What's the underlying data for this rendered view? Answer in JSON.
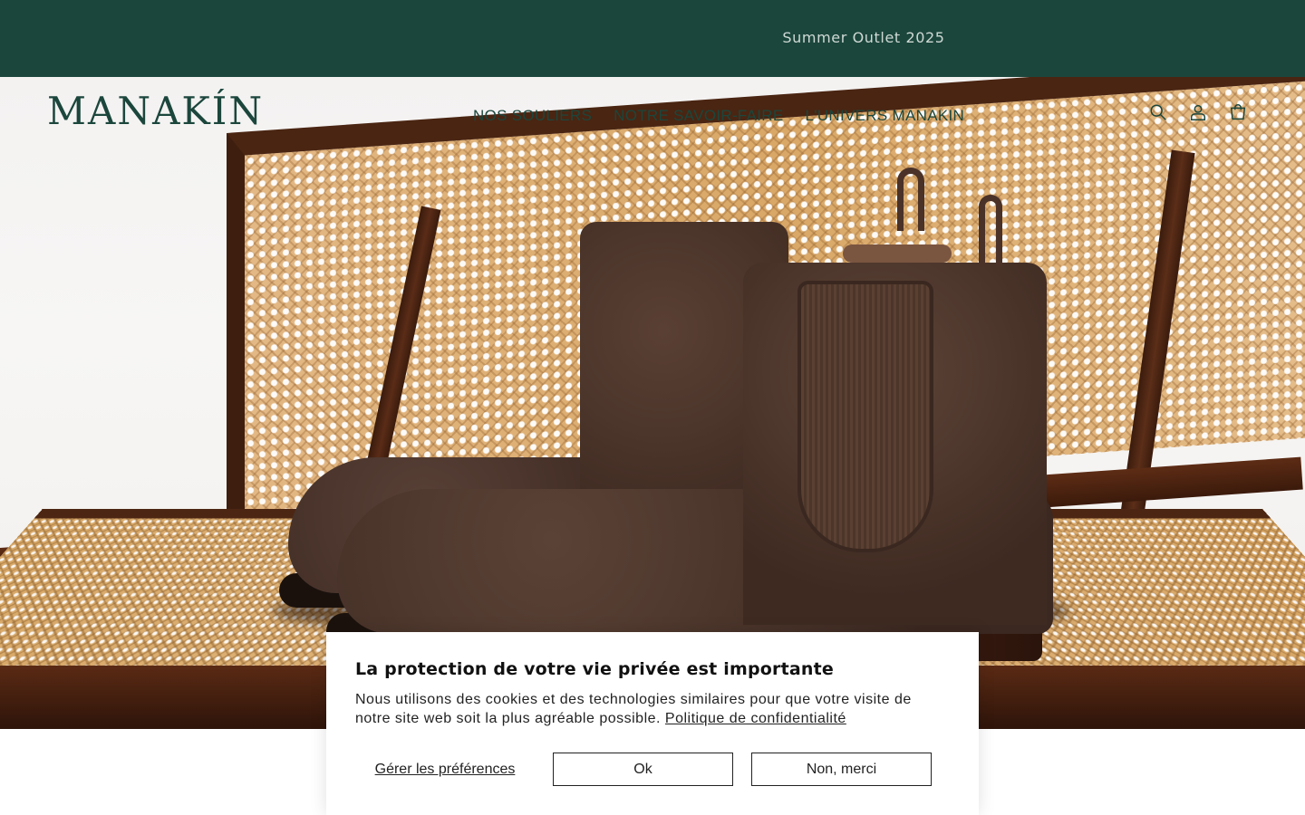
{
  "announcement": {
    "text": "Summer Outlet 2025"
  },
  "brand": {
    "logo_text": "MANAKÍN",
    "color": "#1b463c"
  },
  "nav": {
    "items": [
      {
        "label": "NOS SOULIERS"
      },
      {
        "label": "NOTRE SAVOIR-FAIRE"
      },
      {
        "label": "L'UNIVERS MANAKIN"
      }
    ]
  },
  "header_icons": [
    "search-icon",
    "account-icon",
    "cart-icon"
  ],
  "hero": {
    "image": "brown-suede-chelsea-boots-on-cane-chair"
  },
  "cookie_banner": {
    "title": "La protection de votre vie privée est importante",
    "body": "Nous utilisons des cookies et des technologies similaires pour que votre visite de notre site web soit la plus agréable possible.",
    "policy_link": "Politique de confidentialité",
    "manage_label": "Gérer les préférences",
    "accept_label": "Ok",
    "decline_label": "Non, merci"
  }
}
